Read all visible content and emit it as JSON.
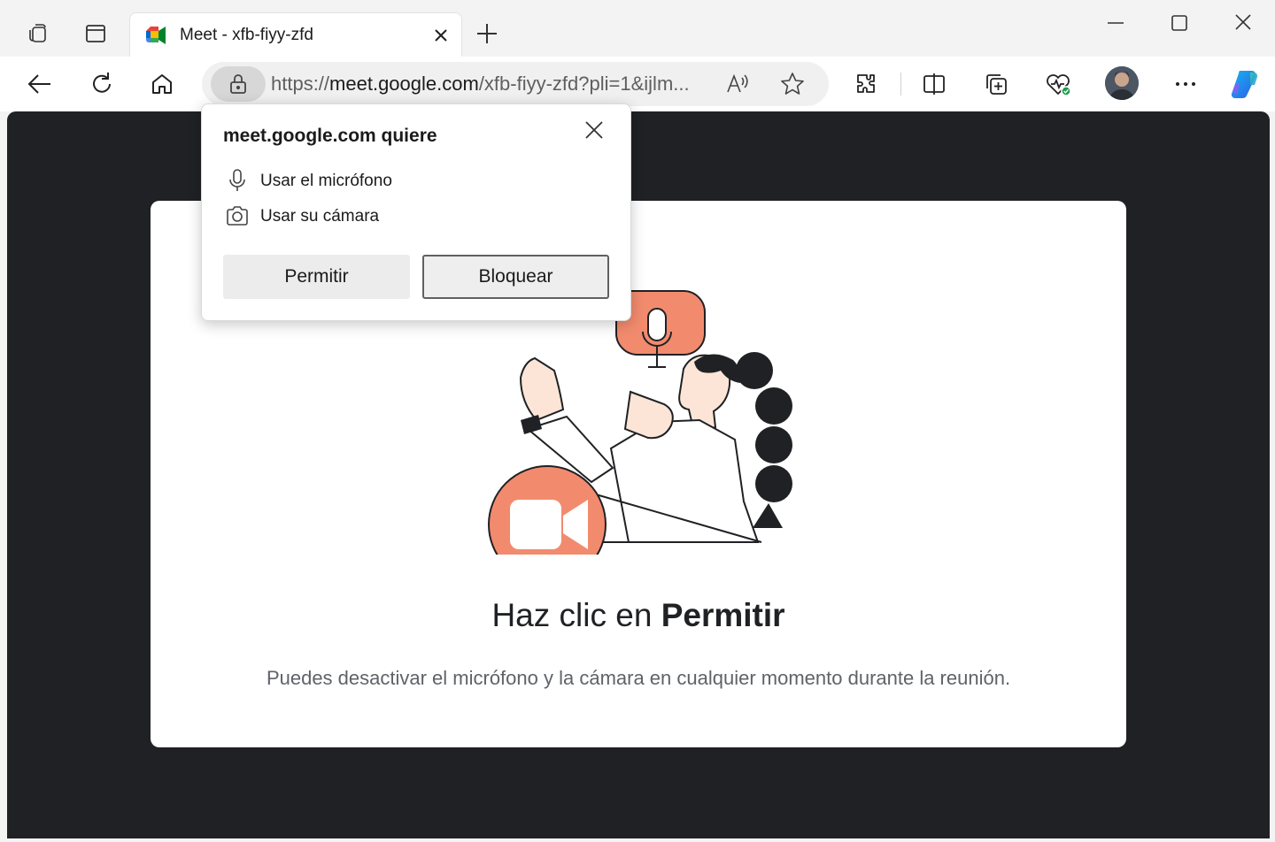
{
  "tab": {
    "title": "Meet - xfb-fiyy-zfd"
  },
  "address_bar": {
    "url_scheme": "https://",
    "url_domain": "meet.google.com",
    "url_rest": "/xfb-fiyy-zfd?pli=1&ijlm..."
  },
  "permission_popup": {
    "title": "meet.google.com quiere",
    "permissions": [
      {
        "label": "Usar el micrófono",
        "icon": "microphone-icon"
      },
      {
        "label": "Usar su cámara",
        "icon": "camera-icon"
      }
    ],
    "allow_label": "Permitir",
    "block_label": "Bloquear"
  },
  "page": {
    "headline_prefix": "Haz clic en ",
    "headline_bold": "Permitir",
    "subtext": "Puedes desactivar el micrófono y la cámara en cualquier momento durante la reunión."
  },
  "colors": {
    "accent_coral": "#f28b6e",
    "content_bg": "#202124",
    "copilot_blue": "#2d7cf0"
  }
}
